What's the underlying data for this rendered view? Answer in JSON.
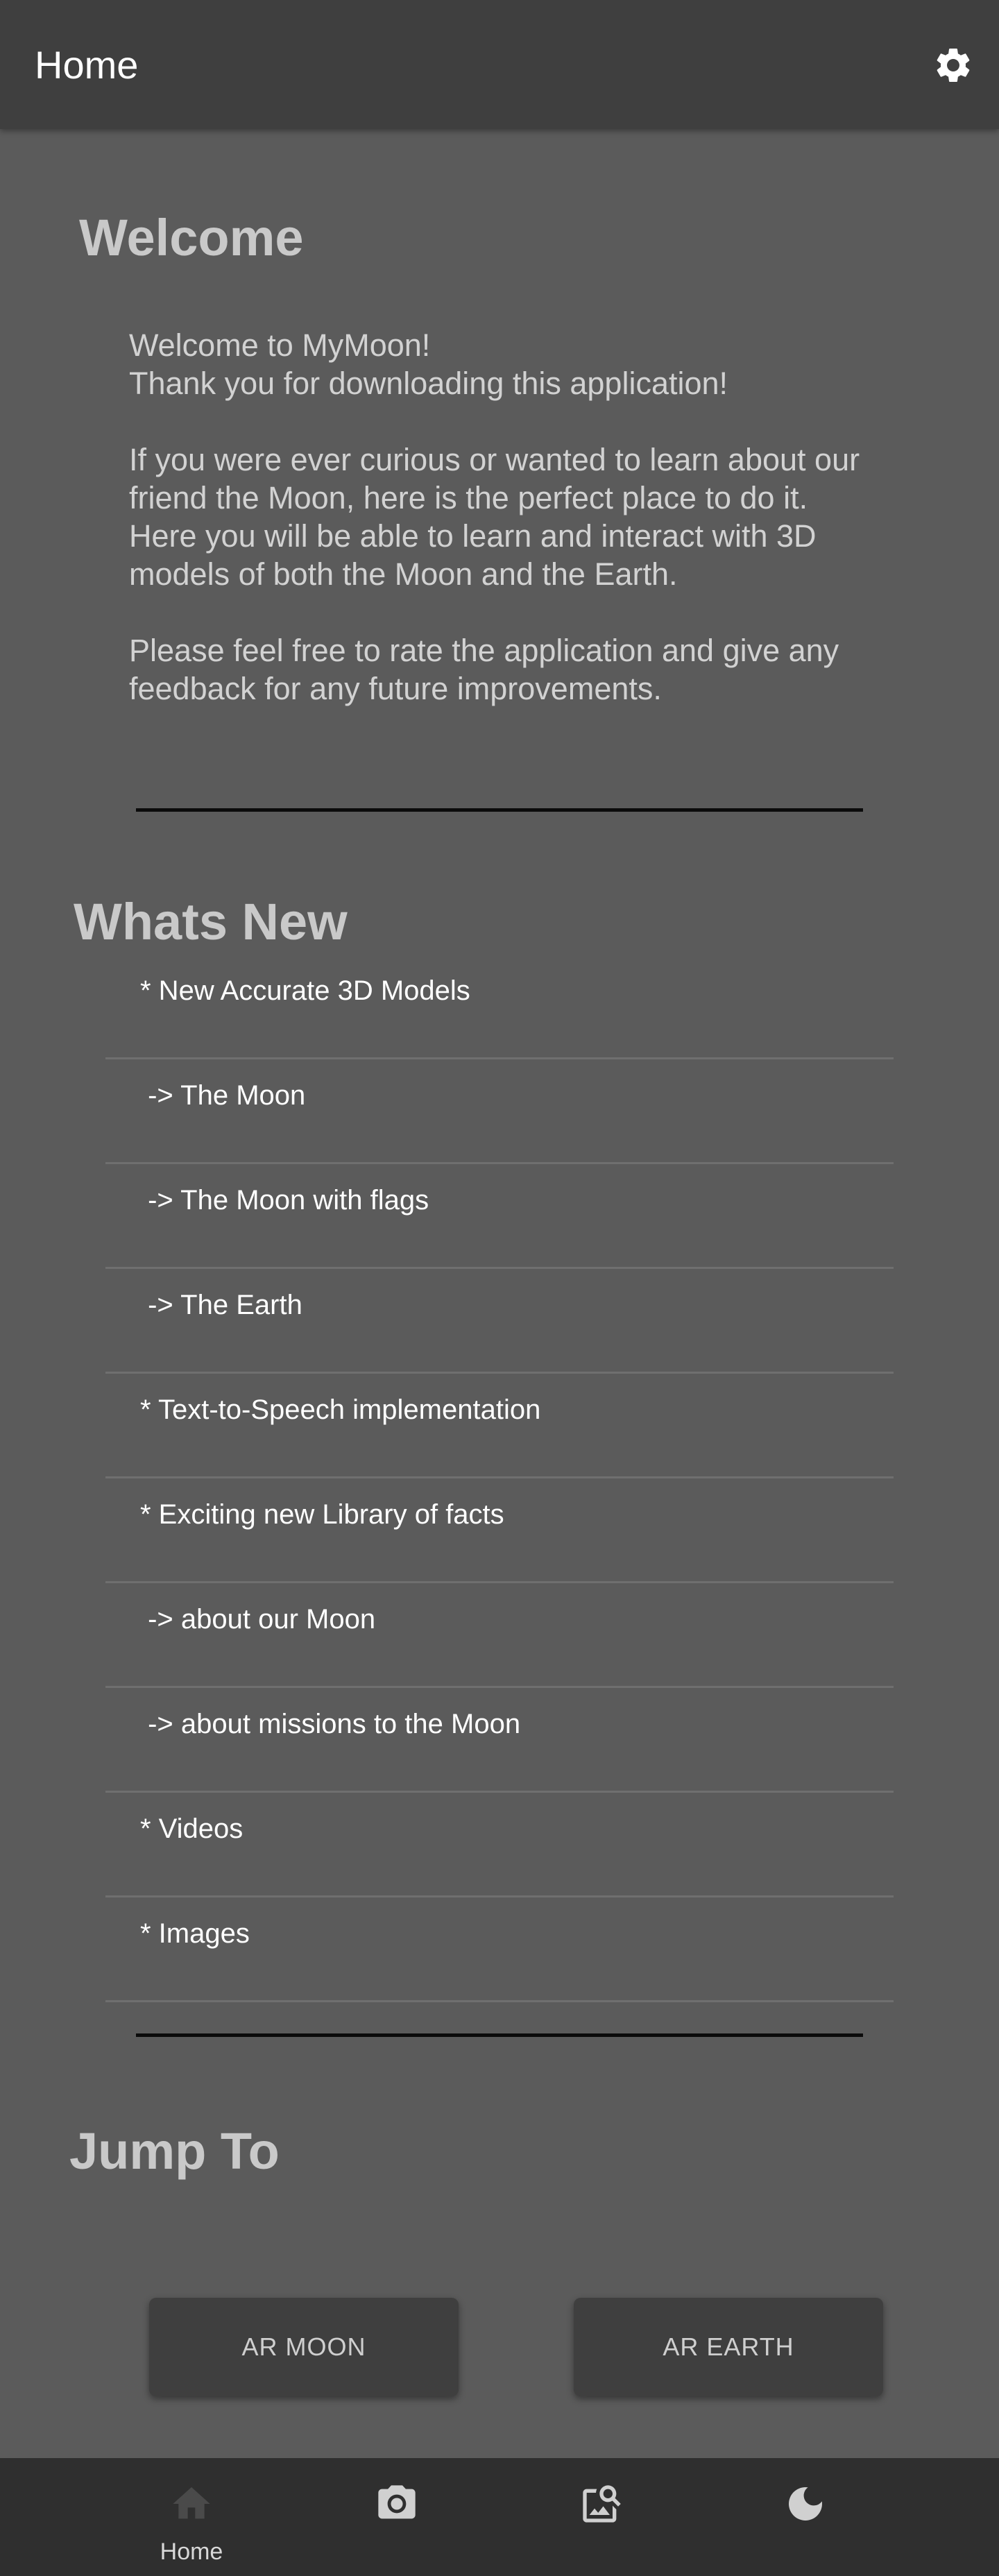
{
  "app_bar": {
    "title": "Home",
    "settings_icon": "gear-icon"
  },
  "welcome": {
    "heading": "Welcome",
    "body": "Welcome to MyMoon!\nThank you for downloading this application!\n\n If you were ever curious or wanted to learn about our friend the Moon, here is the perfect place to do it.\nHere you will be able to learn and interact with 3D models of both the Moon and the Earth.\n\nPlease feel free to rate the application and give any feedback for any future improvements."
  },
  "whats_new": {
    "heading": "Whats New",
    "items": [
      "* New Accurate 3D Models",
      " -> The Moon",
      " -> The Moon with flags",
      " -> The Earth",
      "* Text-to-Speech implementation",
      "* Exciting new Library of facts",
      " -> about our Moon",
      " -> about missions to the Moon",
      "* Videos",
      "* Images"
    ]
  },
  "jump_to": {
    "heading": "Jump To",
    "buttons": [
      "AR MOON",
      "AR EARTH"
    ]
  },
  "bottom_nav": {
    "items": [
      {
        "icon": "home-icon",
        "label": "Home"
      },
      {
        "icon": "camera-icon",
        "label": ""
      },
      {
        "icon": "image-search-icon",
        "label": ""
      },
      {
        "icon": "moon-icon",
        "label": ""
      }
    ]
  },
  "colors": {
    "background": "#5b5b5b",
    "app_bar": "#3f3f3f",
    "bottom_nav": "#2f2f2f",
    "heading": "#c9c9c9",
    "text": "#ffffff"
  }
}
